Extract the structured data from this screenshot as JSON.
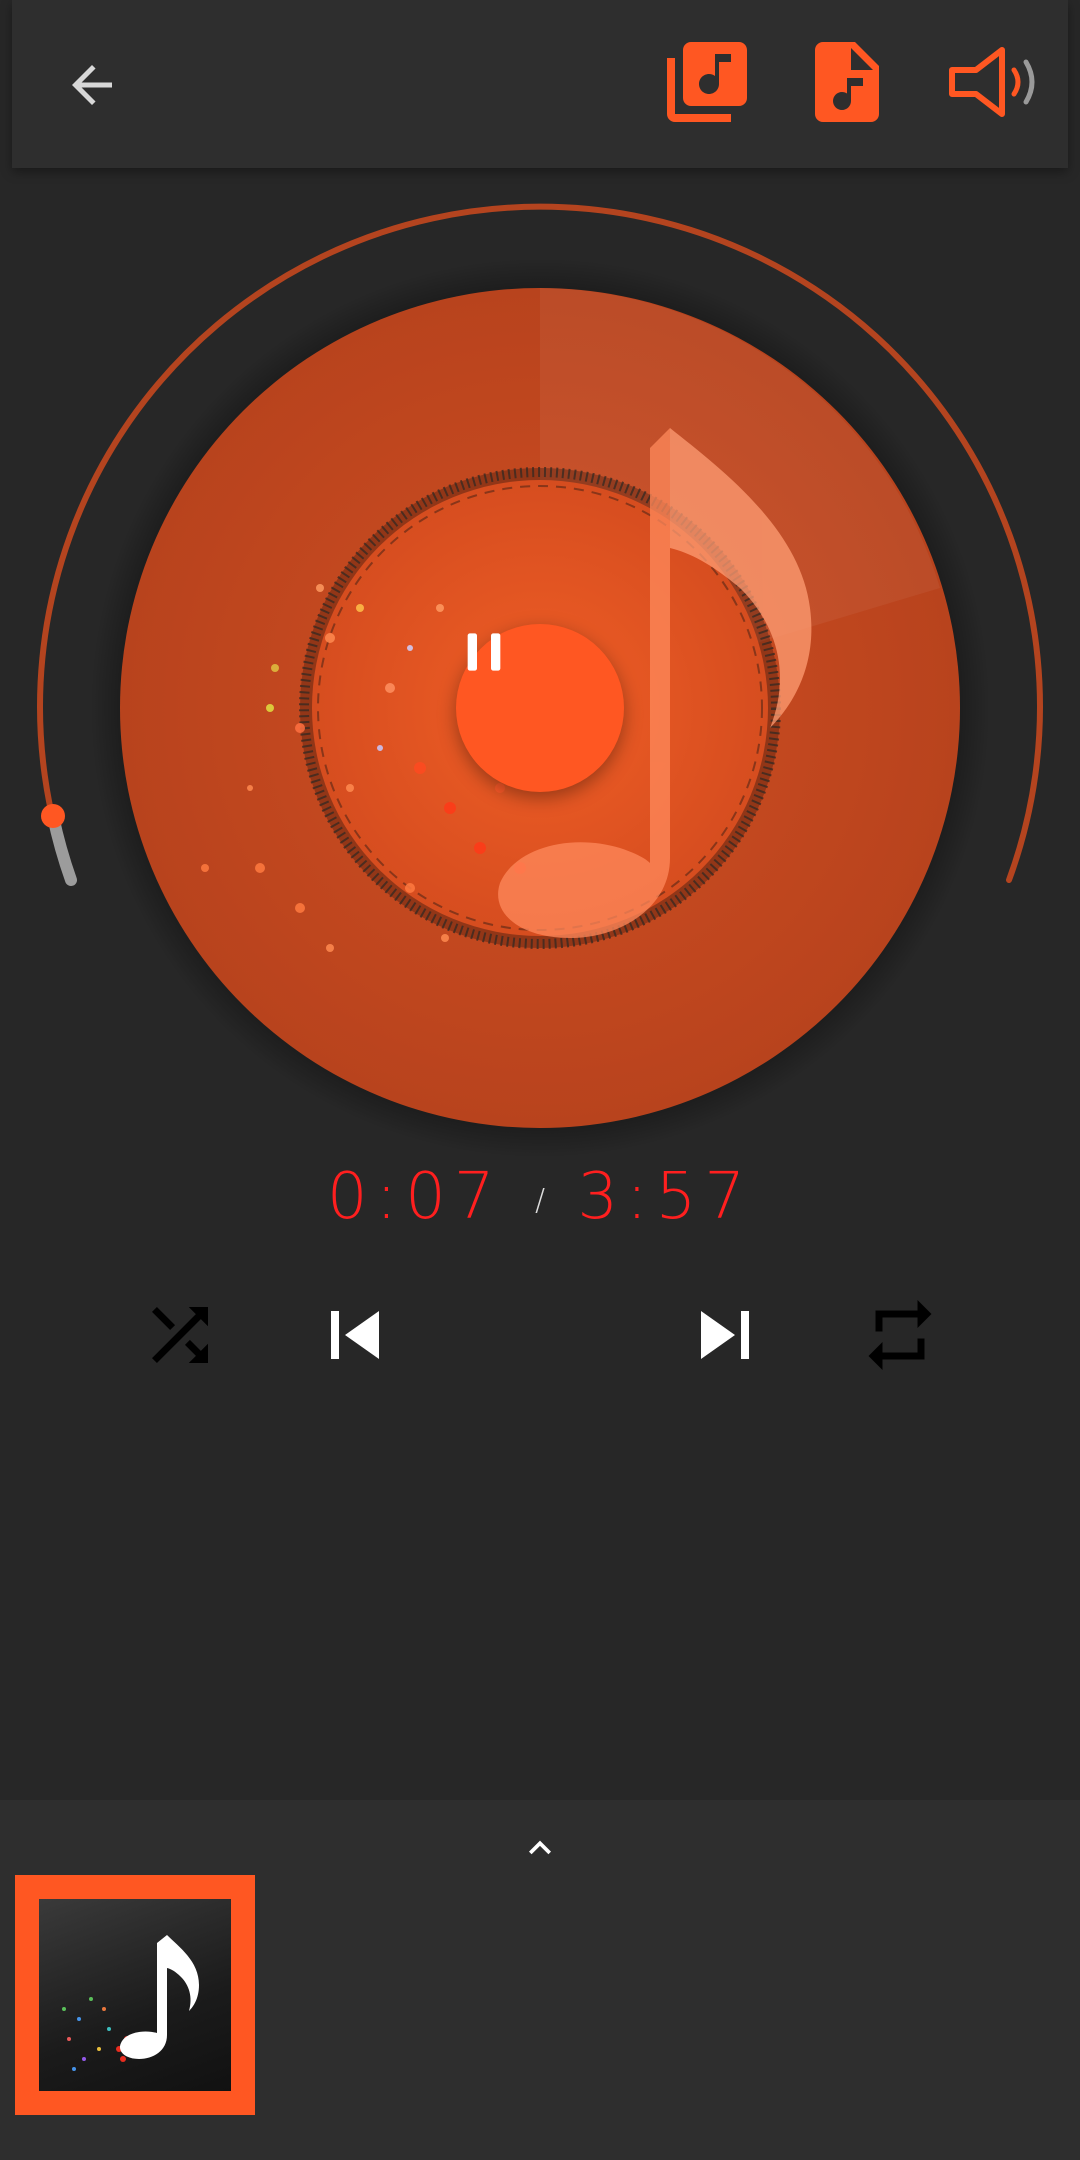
{
  "header": {
    "back_icon": "arrow-left-icon",
    "playlist_icon": "library-music-icon",
    "file_icon": "audio-file-icon",
    "volume_icon": "volume-icon"
  },
  "player": {
    "state_icon": "pause-icon",
    "elapsed": "0:07",
    "separator": "/",
    "total": "3:57",
    "progress": 0.03
  },
  "controls": {
    "shuffle_icon": "shuffle-icon",
    "previous_icon": "skip-previous-icon",
    "next_icon": "skip-next-icon",
    "repeat_icon": "repeat-icon"
  },
  "queue": {
    "expand_icon": "chevron-up-icon",
    "items": [
      {
        "art": "album-art-music-note"
      }
    ]
  },
  "colors": {
    "accent": "#ff5722",
    "disc": "#c0461f",
    "time_text": "#ff1f1f",
    "background": "#272727"
  }
}
